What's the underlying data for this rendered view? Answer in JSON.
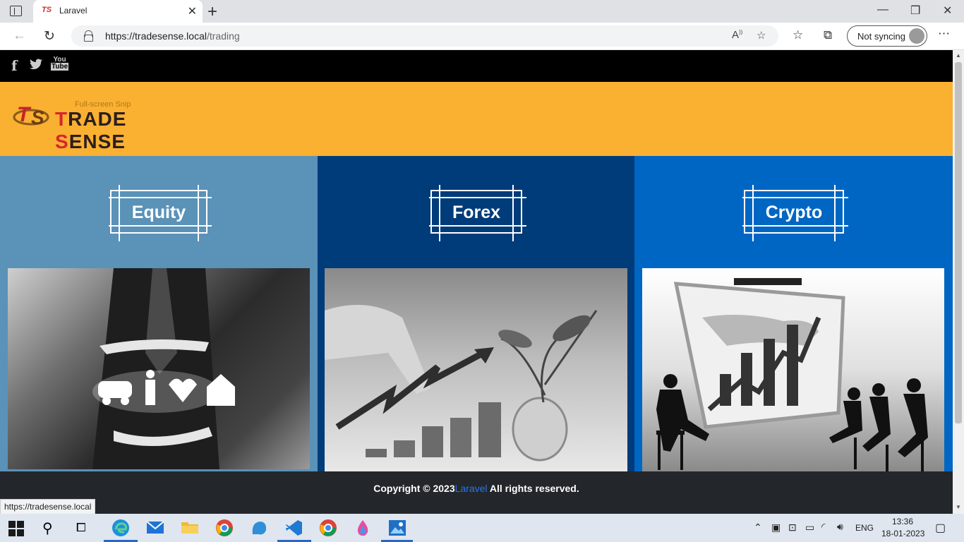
{
  "browser": {
    "tab_title": "Laravel",
    "url_host": "https://tradesense.local",
    "url_path": "/trading",
    "profile_label": "Not syncing",
    "status_url": "https://tradesense.local"
  },
  "site": {
    "social": [
      "f",
      "twitter",
      "YouTube"
    ],
    "logo_text_1": "T",
    "logo_text_2": "RADE ",
    "logo_text_3": "S",
    "logo_text_4": "ENSE",
    "snip_hint": "Full-screen Snip",
    "categories": [
      {
        "label": "Equity"
      },
      {
        "label": "Forex"
      },
      {
        "label": "Crypto"
      }
    ],
    "footer": {
      "prefix": "Copyright © 2023",
      "link": "Laravel",
      "suffix": " All rights reserved."
    }
  },
  "taskbar": {
    "lang": "ENG",
    "time": "13:36",
    "date": "18-01-2023"
  },
  "colors": {
    "header": "#fab031",
    "equity": "#5a92b8",
    "forex": "#003b7a",
    "crypto": "#0066c3",
    "footer": "#23272b"
  }
}
